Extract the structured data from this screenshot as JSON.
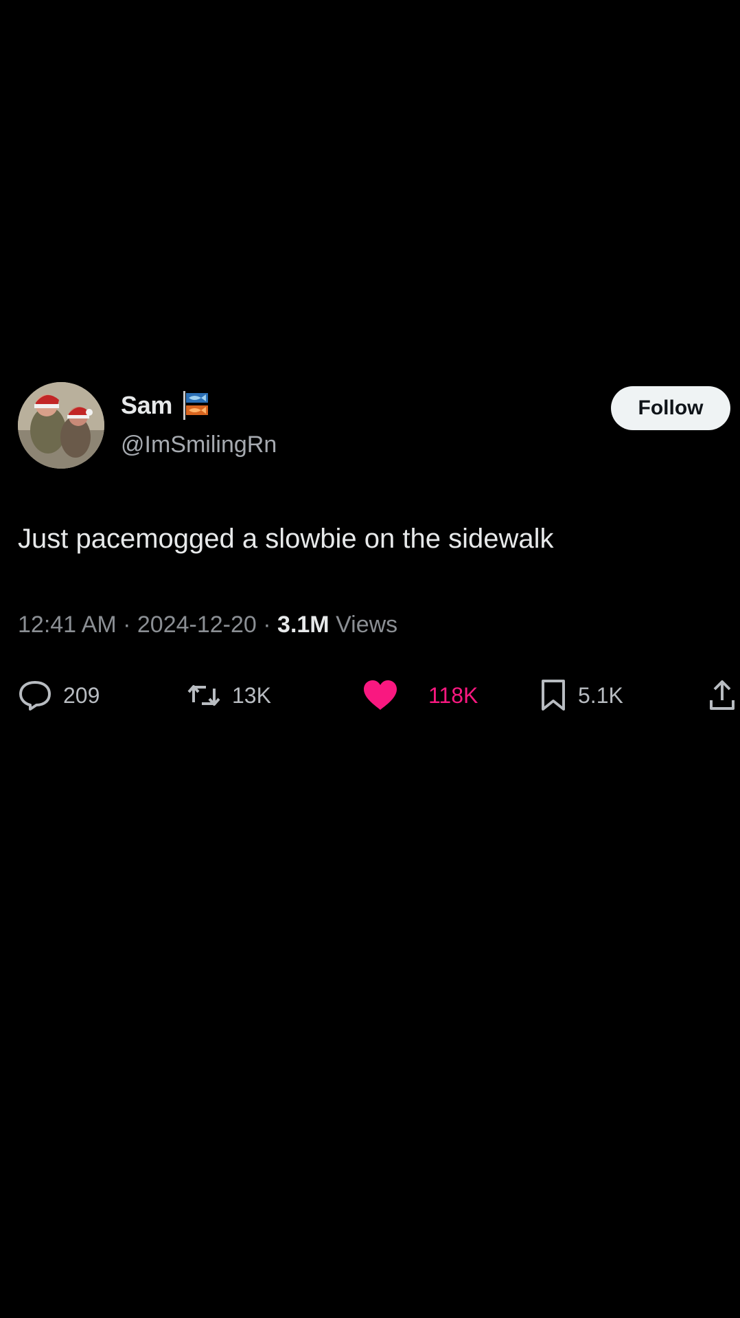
{
  "tweet": {
    "author": {
      "display_name": "Sam",
      "handle": "@ImSmilingRn",
      "avatar_icon": "avatar-photo",
      "badge_icon": "fish-flag-icon"
    },
    "follow_label": "Follow",
    "text": "Just pacemogged a slowbie on the sidewalk",
    "meta": {
      "time": "12:41 AM",
      "separator": "·",
      "date": "2024-12-20",
      "views_count": "3.1M",
      "views_label": "Views"
    },
    "actions": {
      "replies": "209",
      "reposts": "13K",
      "likes": "118K",
      "bookmarks": "5.1K"
    }
  },
  "colors": {
    "background": "#000000",
    "text_primary": "#e7e9ea",
    "text_secondary": "#8b8f94",
    "like_active": "#f91880",
    "follow_button_bg": "#eff3f4"
  }
}
